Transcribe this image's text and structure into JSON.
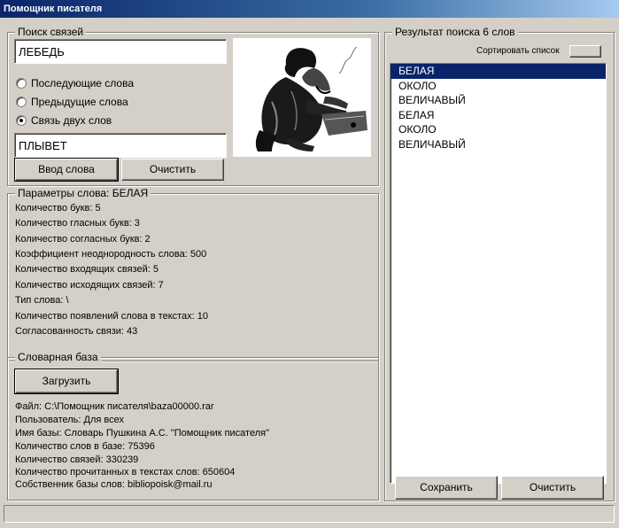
{
  "window": {
    "title": "Помощник писателя"
  },
  "search": {
    "legend": "Поиск связей",
    "word1": "ЛЕБЕДЬ",
    "word2": "ПЛЫВЕТ",
    "options": [
      {
        "label": "Последующие слова",
        "checked": false
      },
      {
        "label": "Предыдущие слова",
        "checked": false
      },
      {
        "label": "Связь двух слов",
        "checked": true
      }
    ],
    "enter_label": "Ввод слова",
    "clear_label": "Очистить"
  },
  "params": {
    "legend": "Параметры слова: БЕЛАЯ",
    "lines": [
      "Количество букв: 5",
      "Количество гласных букв: 3",
      "Количество согласных букв: 2",
      "Коэффициент неоднородность слова: 500",
      "Количество входящих связей: 5",
      "Количество исходящих связей: 7",
      "Тип слова: \\",
      "Количество появлений слова в текстах: 10",
      "Согласованность связи: 43"
    ]
  },
  "base": {
    "legend": "Словарная база",
    "load_label": "Загрузить",
    "lines": [
      "Файл: C:\\Помощник писателя\\baza00000.rar",
      "Пользователь: Для всех",
      "Имя базы: Словарь Пушкина А.С. \"Помощник писателя\"",
      "Количество слов в базе: 75396",
      "Количество связей: 330239",
      "Количество прочитанных в текстах слов: 650604",
      "Собственник базы слов: bibliopoisk@mail.ru"
    ]
  },
  "results": {
    "legend": "Результат поиска 6 слов",
    "sort_label": "Сортировать список",
    "items": [
      "БЕЛАЯ",
      "ОКОЛО",
      "ВЕЛИЧАВЫЙ",
      "БЕЛАЯ",
      "ОКОЛО",
      "ВЕЛИЧАВЫЙ"
    ],
    "selected_index": 0,
    "save_label": "Сохранить",
    "clear_label": "Очистить"
  },
  "colors": {
    "face": "#d4d0c8",
    "selection": "#0a246a",
    "title_start": "#0a246a"
  }
}
